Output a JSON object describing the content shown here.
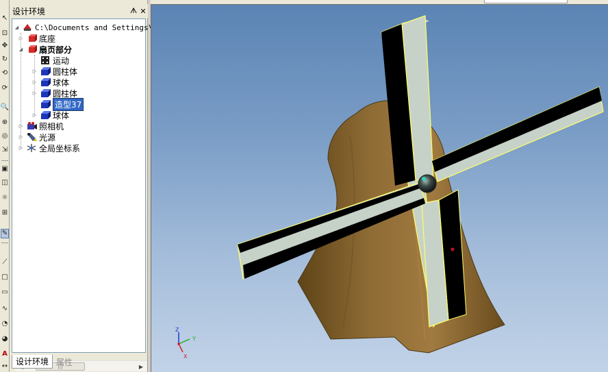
{
  "panel": {
    "title": "设计环境",
    "pin_glyph": "ᗑ",
    "close_glyph": "✕"
  },
  "tree": {
    "root": "C:\\Documents and Settings\\Ad",
    "items": [
      {
        "label": "底座"
      },
      {
        "label": "扇页部分"
      },
      {
        "label": "运动"
      },
      {
        "label": "圆柱体"
      },
      {
        "label": "球体"
      },
      {
        "label": "圆柱体"
      },
      {
        "label": "造型37"
      },
      {
        "label": "球体"
      },
      {
        "label": "照相机"
      },
      {
        "label": "光源"
      },
      {
        "label": "全局坐标系"
      }
    ]
  },
  "scrollbar": {
    "left": "◀",
    "right": "▶",
    "thumb": "|||"
  },
  "tabs": {
    "design": "设计环境",
    "properties": "属性"
  },
  "axis": {
    "z": "Z",
    "y": "Y",
    "x": "X"
  },
  "colors": {
    "selection": "#3169c6",
    "blade_light": "#c6d2c8",
    "blade_dark": "#000000",
    "highlight": "#ffff66",
    "tower": "#8c6a34"
  }
}
